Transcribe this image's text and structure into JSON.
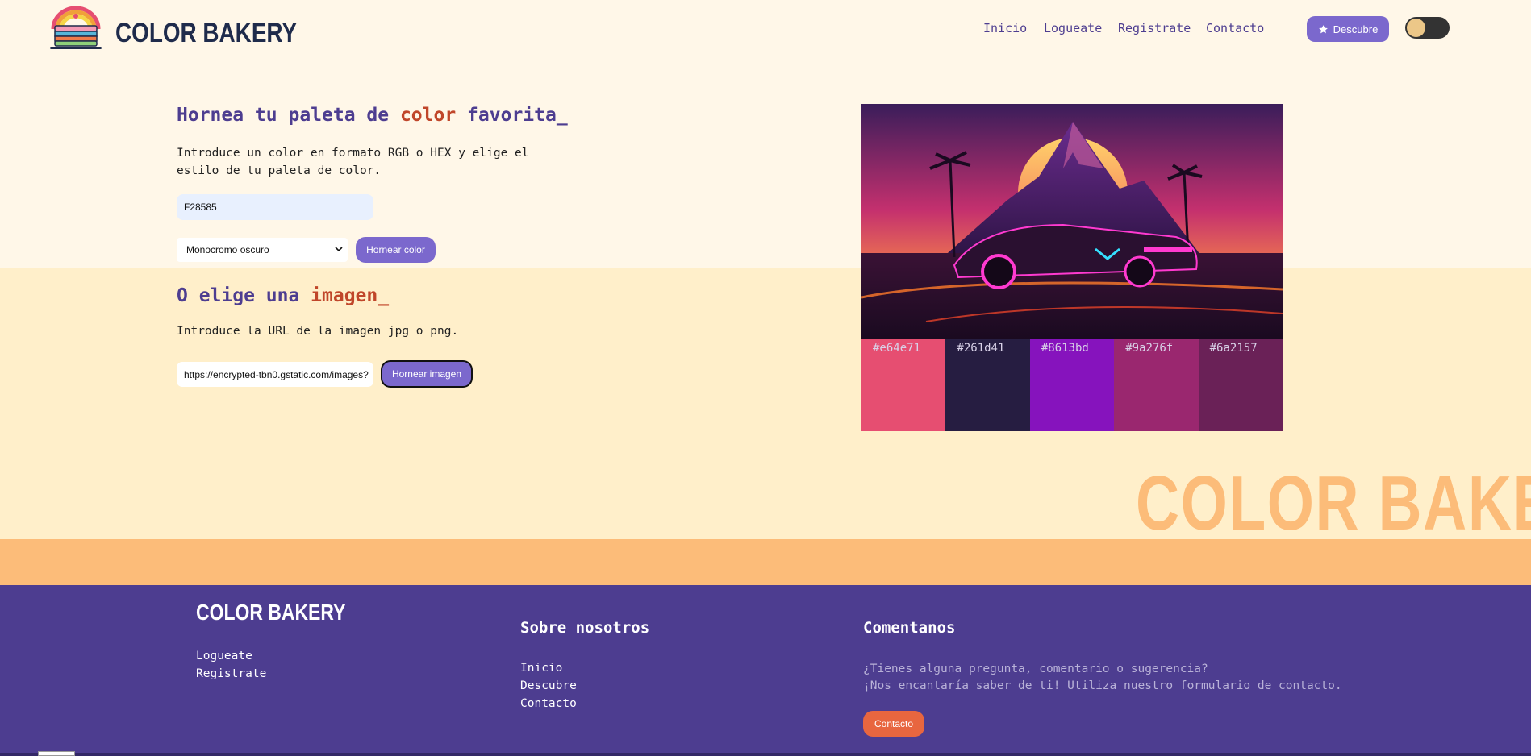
{
  "header": {
    "brand": "COLOR BAKERY",
    "nav": [
      "Inicio",
      "Logueate",
      "Registrate",
      "Contacto"
    ],
    "descubre_button": "Descubre",
    "theme_toggle_icon": "toggle-switch-icon"
  },
  "color_section": {
    "title_part1": "Hornea tu paleta de ",
    "title_accent": "color",
    "title_part2": " favorita_",
    "description": "Introduce un color en formato RGB o HEX y elige el estilo de tu paleta de color.",
    "color_input_value": "F28585",
    "style_select_value": "Monocromo oscuro",
    "bake_button": "Hornear color"
  },
  "image_section": {
    "title_part1": "O elige una ",
    "title_accent": "imagen_",
    "description": "Introduce la URL de la imagen jpg o png.",
    "url_input_value": "https://encrypted-tbn0.gstatic.com/images?",
    "bake_button": "Hornear imagen"
  },
  "palette": {
    "swatches": [
      {
        "hex": "#e64e71"
      },
      {
        "hex": "#261d41"
      },
      {
        "hex": "#8613bd"
      },
      {
        "hex": "#9a276f"
      },
      {
        "hex": "#6a2157"
      }
    ]
  },
  "watermark": "COLOR BAKERY",
  "footer": {
    "brand": "COLOR BAKERY",
    "links_left": [
      "Logueate",
      "Registrate"
    ],
    "about_title": "Sobre nosotros",
    "about_links": [
      "Inicio",
      "Descubre",
      "Contacto"
    ],
    "comment_title": "Comentanos",
    "comment_line1": "¿Tienes alguna pregunta, comentario o sugerencia?",
    "comment_line2": "¡Nos encantaría saber de ti! Utiliza nuestro formulario de contacto.",
    "contact_button": "Contacto"
  },
  "colors": {
    "brand_purple": "#4d3d90",
    "button_purple": "#7b68cd",
    "accent_red": "#c0462a",
    "orange": "#fcbc79",
    "contact_orange": "#e8663f"
  }
}
